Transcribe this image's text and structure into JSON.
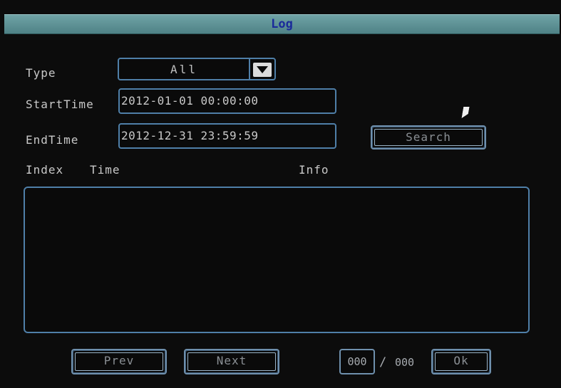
{
  "window": {
    "title": "Log"
  },
  "filters": {
    "type_label": "Type",
    "type_value": "All",
    "start_label": "StartTime",
    "start_value": "2012-01-01 00:00:00",
    "end_label": "EndTime",
    "end_value": "2012-12-31 23:59:59",
    "search_label": "Search"
  },
  "results": {
    "columns": [
      "Index",
      "Time",
      "Info"
    ],
    "rows": []
  },
  "pager": {
    "prev_label": "Prev",
    "next_label": "Next",
    "page_value": "000",
    "separator": "/",
    "total_pages": "000",
    "ok_label": "Ok"
  },
  "colors": {
    "titlebar": "#5f9397",
    "title_text": "#1a2a9a",
    "border": "#4f7fa8",
    "text": "#c9c9c9"
  },
  "icons": {
    "dropdown": "chevron-down-icon",
    "pointer": "mouse-cursor-icon"
  }
}
